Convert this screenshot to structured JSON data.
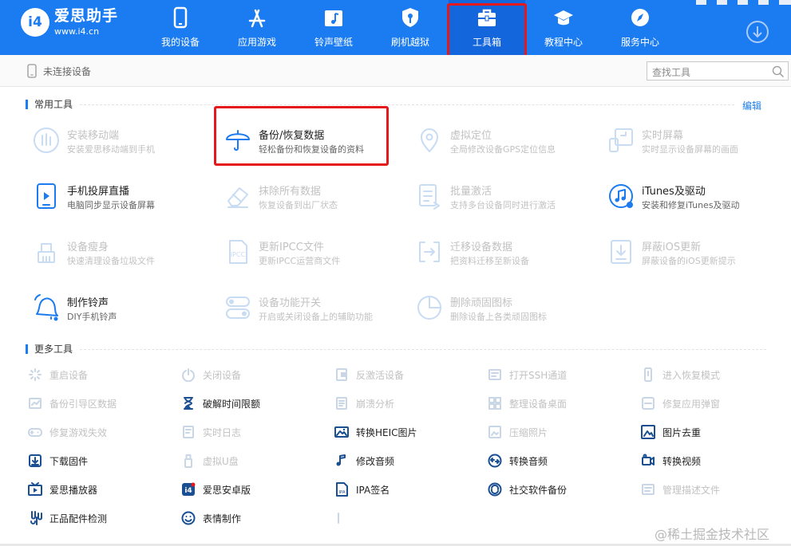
{
  "header": {
    "brand_name": "爱思助手",
    "brand_url": "www.i4.cn",
    "logo_glyph": "i4",
    "bg_color": "#1b7bf0",
    "nav": [
      {
        "label": "我的设备",
        "icon": "phone-icon"
      },
      {
        "label": "应用游戏",
        "icon": "app-store-icon"
      },
      {
        "label": "铃声壁纸",
        "icon": "music-image-icon"
      },
      {
        "label": "刷机越狱",
        "icon": "shield-key-icon"
      },
      {
        "label": "工具箱",
        "icon": "toolbox-icon",
        "active": true
      },
      {
        "label": "教程中心",
        "icon": "graduation-cap-icon"
      },
      {
        "label": "服务中心",
        "icon": "compass-icon"
      }
    ],
    "download_icon": "download-circle-icon"
  },
  "statusbar": {
    "device_status": "未连接设备",
    "search_placeholder": "查找工具"
  },
  "common": {
    "title": "常用工具",
    "edit": "编辑",
    "tools": [
      {
        "name": "安装移动端",
        "desc": "安装爱思移动端到手机",
        "icon": "install-mobile-icon",
        "enabled": false
      },
      {
        "name": "备份/恢复数据",
        "desc": "轻松备份和恢复设备的资料",
        "icon": "umbrella-icon",
        "enabled": true
      },
      {
        "name": "虚拟定位",
        "desc": "全局修改设备GPS定位信息",
        "icon": "location-pin-icon",
        "enabled": false
      },
      {
        "name": "实时屏幕",
        "desc": "实时显示设备屏幕的画面",
        "icon": "screen-mirror-icon",
        "enabled": false
      },
      {
        "name": "手机投屏直播",
        "desc": "电脑同步显示设备屏幕",
        "icon": "phone-cast-icon",
        "enabled": true
      },
      {
        "name": "抹除所有数据",
        "desc": "恢复设备到出厂状态",
        "icon": "eraser-icon",
        "enabled": false
      },
      {
        "name": "批量激活",
        "desc": "支持多台设备同时进行激活",
        "icon": "batch-activate-icon",
        "enabled": false
      },
      {
        "name": "iTunes及驱动",
        "desc": "安装和修复iTunes及驱动",
        "icon": "itunes-icon",
        "enabled": true
      },
      {
        "name": "设备瘦身",
        "desc": "快速清理设备垃圾文件",
        "icon": "broom-icon",
        "enabled": false
      },
      {
        "name": "更新IPCC文件",
        "desc": "更新IPCC运营商文件",
        "icon": "ipcc-file-icon",
        "enabled": false
      },
      {
        "name": "迁移设备数据",
        "desc": "把资料迁移至新设备",
        "icon": "migrate-icon",
        "enabled": false
      },
      {
        "name": "屏蔽iOS更新",
        "desc": "屏蔽设备的iOS更新提示",
        "icon": "block-update-icon",
        "enabled": false
      },
      {
        "name": "制作铃声",
        "desc": "DIY手机铃声",
        "icon": "bell-icon",
        "enabled": true
      },
      {
        "name": "设备功能开关",
        "desc": "开启或关闭设备上的辅助功能",
        "icon": "toggle-icon",
        "enabled": false
      },
      {
        "name": "删除顽固图标",
        "desc": "删除设备上各类顽固图标",
        "icon": "pie-clock-icon",
        "enabled": false
      }
    ]
  },
  "more": {
    "title": "更多工具",
    "tools": [
      {
        "name": "重启设备",
        "icon": "restart-icon",
        "enabled": false
      },
      {
        "name": "关闭设备",
        "icon": "power-icon",
        "enabled": false
      },
      {
        "name": "反激活设备",
        "icon": "deactivate-icon",
        "enabled": false
      },
      {
        "name": "打开SSH通道",
        "icon": "ssh-icon",
        "enabled": false
      },
      {
        "name": "进入恢复模式",
        "icon": "recovery-icon",
        "enabled": false
      },
      {
        "name": "备份引导区数据",
        "icon": "boot-backup-icon",
        "enabled": false
      },
      {
        "name": "破解时间限额",
        "icon": "hourglass-icon",
        "enabled": true
      },
      {
        "name": "崩溃分析",
        "icon": "crash-log-icon",
        "enabled": false
      },
      {
        "name": "整理设备桌面",
        "icon": "desktop-grid-icon",
        "enabled": false
      },
      {
        "name": "修复应用弹窗",
        "icon": "fix-popup-icon",
        "enabled": false
      },
      {
        "name": "修复游戏失效",
        "icon": "gamepad-icon",
        "enabled": false
      },
      {
        "name": "实时日志",
        "icon": "log-icon",
        "enabled": false
      },
      {
        "name": "转换HEIC图片",
        "icon": "heic-image-icon",
        "enabled": true
      },
      {
        "name": "压缩照片",
        "icon": "compress-photo-icon",
        "enabled": false
      },
      {
        "name": "图片去重",
        "icon": "dedupe-image-icon",
        "enabled": true
      },
      {
        "name": "下载固件",
        "icon": "firmware-download-icon",
        "enabled": true
      },
      {
        "name": "虚拟U盘",
        "icon": "usb-drive-icon",
        "enabled": false
      },
      {
        "name": "修改音频",
        "icon": "audio-edit-icon",
        "enabled": true
      },
      {
        "name": "转换音频",
        "icon": "audio-convert-icon",
        "enabled": true
      },
      {
        "name": "转换视频",
        "icon": "video-convert-icon",
        "enabled": true
      },
      {
        "name": "爱思播放器",
        "icon": "player-icon",
        "enabled": true
      },
      {
        "name": "爱思安卓版",
        "icon": "i4-android-icon",
        "enabled": true
      },
      {
        "name": "IPA签名",
        "icon": "ipa-sign-icon",
        "enabled": true
      },
      {
        "name": "社交软件备份",
        "icon": "social-backup-icon",
        "enabled": true
      },
      {
        "name": "管理描述文件",
        "icon": "profile-icon",
        "enabled": false
      },
      {
        "name": "正品配件检测",
        "icon": "accessory-check-icon",
        "enabled": true
      },
      {
        "name": "表情制作",
        "icon": "emoji-icon",
        "enabled": true
      },
      {
        "name": "",
        "icon": "partial-tool-icon",
        "enabled": false
      }
    ]
  },
  "watermark": "@稀土掘金技术社区",
  "colors": {
    "accent": "#1b7bf0",
    "highlight": "#e5191c",
    "disabled": "#c2c2c2"
  }
}
